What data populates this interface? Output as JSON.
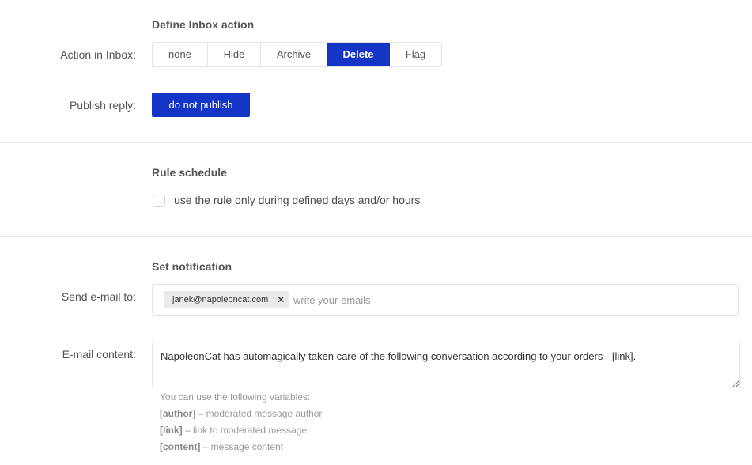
{
  "inbox_action": {
    "section_title": "Define Inbox action",
    "label": "Action in Inbox:",
    "options": [
      {
        "label": "none",
        "active": false
      },
      {
        "label": "Hide",
        "active": false
      },
      {
        "label": "Archive",
        "active": false
      },
      {
        "label": "Delete",
        "active": true
      },
      {
        "label": "Flag",
        "active": false
      }
    ],
    "selected": "Delete"
  },
  "publish_reply": {
    "label": "Publish reply:",
    "button_label": "do not publish"
  },
  "schedule": {
    "section_title": "Rule schedule",
    "checkbox_label": "use the rule only during defined days and/or hours",
    "checked": false
  },
  "notification": {
    "section_title": "Set notification",
    "send_to_label": "Send e-mail to:",
    "recipients": [
      "janek@napoleoncat.com"
    ],
    "remove_icon": "close-icon",
    "email_input_placeholder": "write your emails",
    "content_label": "E-mail content:",
    "content_value": "NapoleonCat has automagically taken care of the following conversation according to your orders - [link].",
    "hint_intro": "You can use the following variables:",
    "variables": [
      {
        "name": "[author]",
        "desc": " – moderated message author"
      },
      {
        "name": "[link]",
        "desc": " – link to moderated message"
      },
      {
        "name": "[content]",
        "desc": " – message content"
      }
    ]
  },
  "colors": {
    "accent": "#1435c6",
    "divider": "#e6e6e6"
  }
}
